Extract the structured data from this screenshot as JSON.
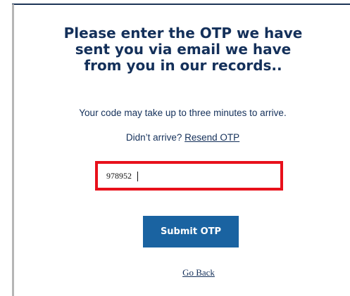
{
  "otp_form": {
    "heading": "Please enter the OTP we have sent you via email we have from you in our records..",
    "arrival_note": "Your code may take up to three minutes to arrive.",
    "resend_prompt": "Didn’t arrive?",
    "resend_link": "Resend OTP",
    "otp_value": "978952",
    "submit_label": "Submit OTP",
    "go_back_label": "Go Back"
  },
  "colors": {
    "heading_text": "#14305a",
    "button_background": "#1a63a1",
    "highlight_border": "#e8101b"
  }
}
